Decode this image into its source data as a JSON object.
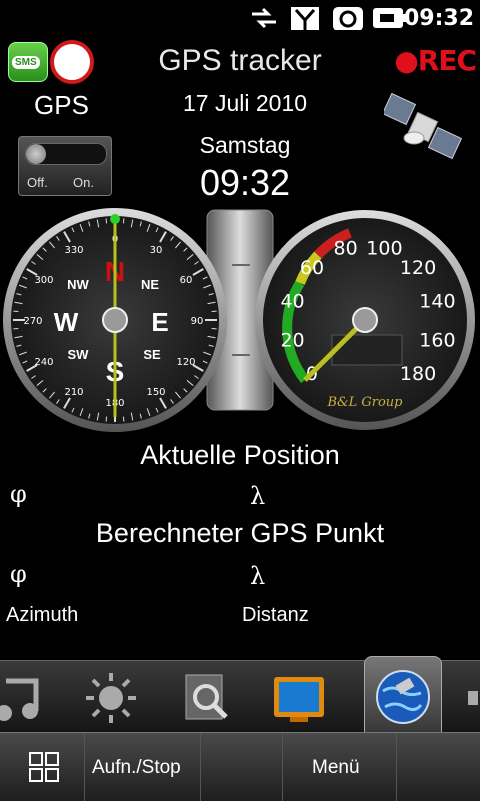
{
  "status_bar": {
    "time": "09:32",
    "icons": [
      "usb-transfer-icon",
      "signal-icon",
      "sync-icon",
      "battery-charging-icon"
    ]
  },
  "header": {
    "title": "GPS tracker",
    "rec_label": "●REC",
    "sms_label": "SMS"
  },
  "gps": {
    "label": "GPS",
    "toggle_off": "Off.",
    "toggle_on": "On."
  },
  "datetime": {
    "date": "17 Juli 2010",
    "weekday": "Samstag",
    "time": "09:32"
  },
  "compass": {
    "directions": {
      "n": "N",
      "ne": "NE",
      "e": "E",
      "se": "SE",
      "s": "S",
      "sw": "SW",
      "w": "W",
      "nw": "NW"
    },
    "ticks": [
      "0",
      "30",
      "60",
      "90",
      "120",
      "150",
      "180",
      "210",
      "240",
      "270",
      "300",
      "330"
    ]
  },
  "speedometer": {
    "ticks": [
      "0",
      "20",
      "40",
      "60",
      "80",
      "100",
      "120",
      "140",
      "160",
      "180"
    ],
    "brand": "B&L Group",
    "value": 0
  },
  "position": {
    "current_title": "Aktuelle Position",
    "phi": "φ",
    "lambda": "λ",
    "calc_title": "Berechneter GPS Punkt",
    "azimuth_label": "Azimuth",
    "distance_label": "Distanz"
  },
  "dock": {
    "items": [
      "music-icon",
      "brightness-icon",
      "search-icon",
      "tv-icon",
      "globe-satellite-icon"
    ]
  },
  "bottom_bar": {
    "rec_stop_label": "Aufn./Stop",
    "menu_label": "Menü"
  },
  "colors": {
    "rec": "#e0101a",
    "needle": "#b8c020",
    "compass_north": "#cc1111"
  }
}
